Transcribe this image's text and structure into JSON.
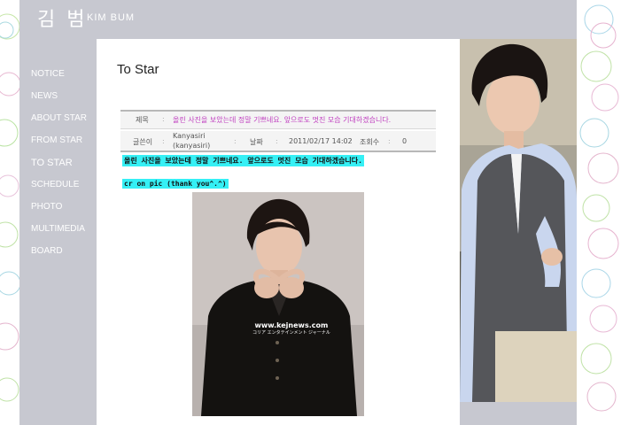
{
  "header": {
    "logo_korean": "김 범",
    "logo_english": "KIM BUM"
  },
  "nav": {
    "items": [
      {
        "label": "NOTICE"
      },
      {
        "label": "NEWS"
      },
      {
        "label": "ABOUT STAR"
      },
      {
        "label": "FROM STAR"
      },
      {
        "label": "TO STAR"
      },
      {
        "label": "SCHEDULE"
      },
      {
        "label": "PHOTO"
      },
      {
        "label": "MULTIMEDIA"
      },
      {
        "label": "BOARD"
      }
    ],
    "active": "TO STAR"
  },
  "page": {
    "title": "To Star"
  },
  "post": {
    "subject_label": "제목",
    "subject": "올린 사진을 보았는데 정말 기쁘네요. 앞으로도 멋진 모습 기대하겠습니다.",
    "author_label": "글쓴이",
    "author_name": "Kanyasiri",
    "author_id": "(kanyasiri)",
    "date_label": "날짜",
    "date": "2011/02/17 14:02",
    "views_label": "조회수",
    "views": "0",
    "body_line1": "올린 사진을 보았는데 정말 기쁘네요. 앞으로도 멋진 모습 기대하겠습니다.",
    "body_line2": "cr on pic (thank you^.^)"
  },
  "photo": {
    "watermark_url": "www.kejnews.com",
    "watermark_sub": "コリア エンタテインメント ジャーナル"
  },
  "colors": {
    "site_bg": "#c7c8d0",
    "highlight": "#35f0f5",
    "subject": "#c040c0"
  }
}
